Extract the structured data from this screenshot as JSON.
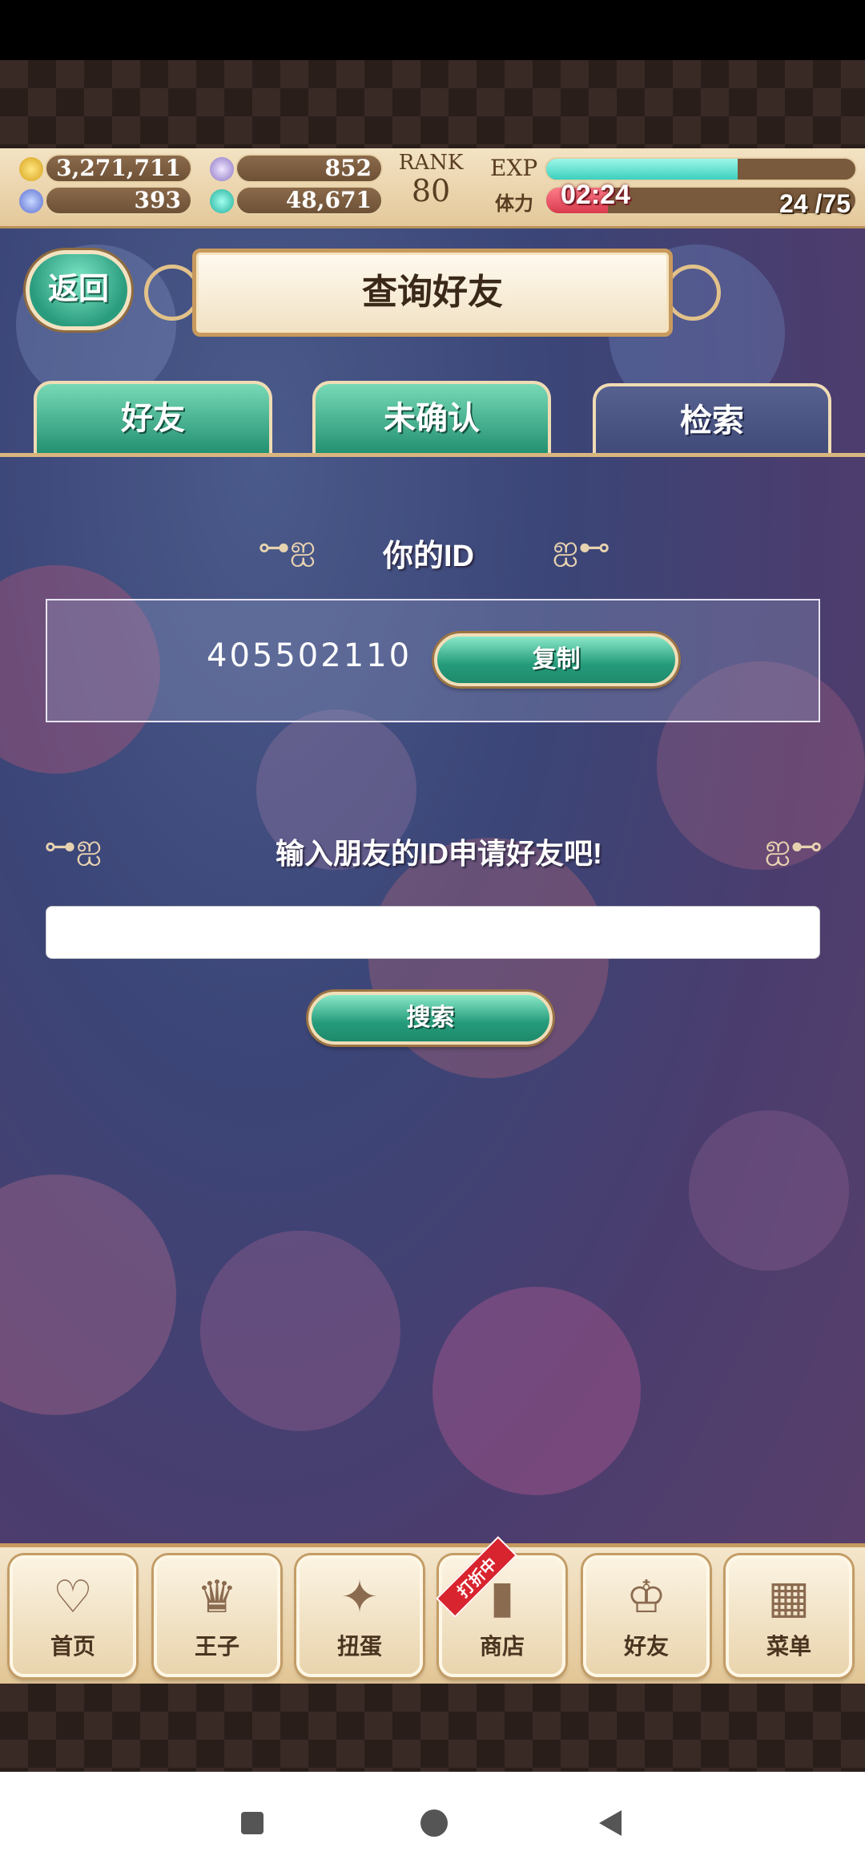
{
  "resources": {
    "gold": "3,271,711",
    "feather": "852",
    "crystal": "393",
    "gem": "48,671"
  },
  "rank": {
    "label": "RANK",
    "value": "80"
  },
  "exp": {
    "label": "EXP",
    "fill_fraction": 0.62
  },
  "stamina": {
    "label": "体力",
    "timer": "02:24",
    "count": "24 /75"
  },
  "header": {
    "back_label": "返回",
    "title": "查询好友"
  },
  "tabs": [
    {
      "label": "好友",
      "active": false
    },
    {
      "label": "未确认",
      "active": false
    },
    {
      "label": "检索",
      "active": true
    }
  ],
  "your_id": {
    "heading": "你的ID",
    "value": "405502110",
    "copy_label": "复制"
  },
  "search": {
    "heading": "输入朋友的ID申请好友吧!",
    "input_value": "",
    "button_label": "搜索"
  },
  "nav": {
    "items": [
      {
        "label": "首页",
        "icon": "heart-icon"
      },
      {
        "label": "王子",
        "icon": "crown-icon"
      },
      {
        "label": "扭蛋",
        "icon": "gacha-icon"
      },
      {
        "label": "商店",
        "icon": "shop-icon"
      },
      {
        "label": "好友",
        "icon": "tiara-icon"
      },
      {
        "label": "菜单",
        "icon": "menu-grid-icon"
      }
    ],
    "sale_badge": "打折中"
  },
  "colors": {
    "accent_green": "#249b7b",
    "banner_cream": "#f1e1c3",
    "stamina_red": "#d93b4e",
    "exp_cyan": "#3ccfbd"
  }
}
